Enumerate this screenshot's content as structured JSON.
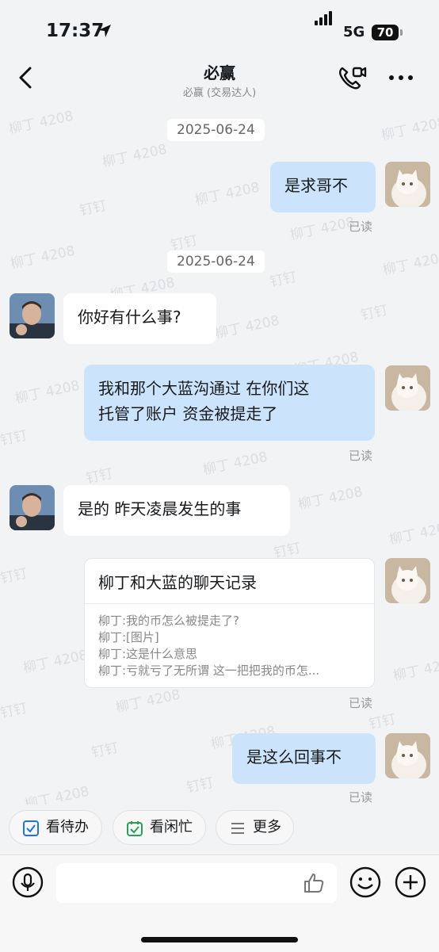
{
  "status_bar": {
    "time": "17:37",
    "network": "5G",
    "battery": "70"
  },
  "header": {
    "title": "必赢",
    "subtitle": "必赢 (交易达人)"
  },
  "watermark": {
    "text_name": "柳丁 4208",
    "text_app": "钉钉"
  },
  "messages": {
    "date_1": "2025-06-24",
    "m1": "是求哥不",
    "read_1": "已读",
    "date_2": "2025-06-24",
    "m2": "你好有什么事?",
    "m3_line1": "我和那个大蓝沟通过 在你们这",
    "m3_line2": "托管了账户 资金被提走了",
    "read_3": "已读",
    "m4": "是的 昨天凌晨发生的事",
    "card": {
      "title": "柳丁和大蓝的聊天记录",
      "lines": [
        "柳丁:我的币怎么被提走了?",
        "柳丁:[图片]",
        "柳丁:这是什么意思",
        "柳丁:亏就亏了无所谓 这一把把我的币怎..."
      ]
    },
    "read_card": "已读",
    "m5": "是这么回事不",
    "read_5": "已读"
  },
  "quick_actions": {
    "todo": "看待办",
    "busy": "看闲忙",
    "more": "更多"
  },
  "colors": {
    "bubble_right": "#cce4fb",
    "accent": "#1a73e8",
    "green": "#22a35a"
  }
}
